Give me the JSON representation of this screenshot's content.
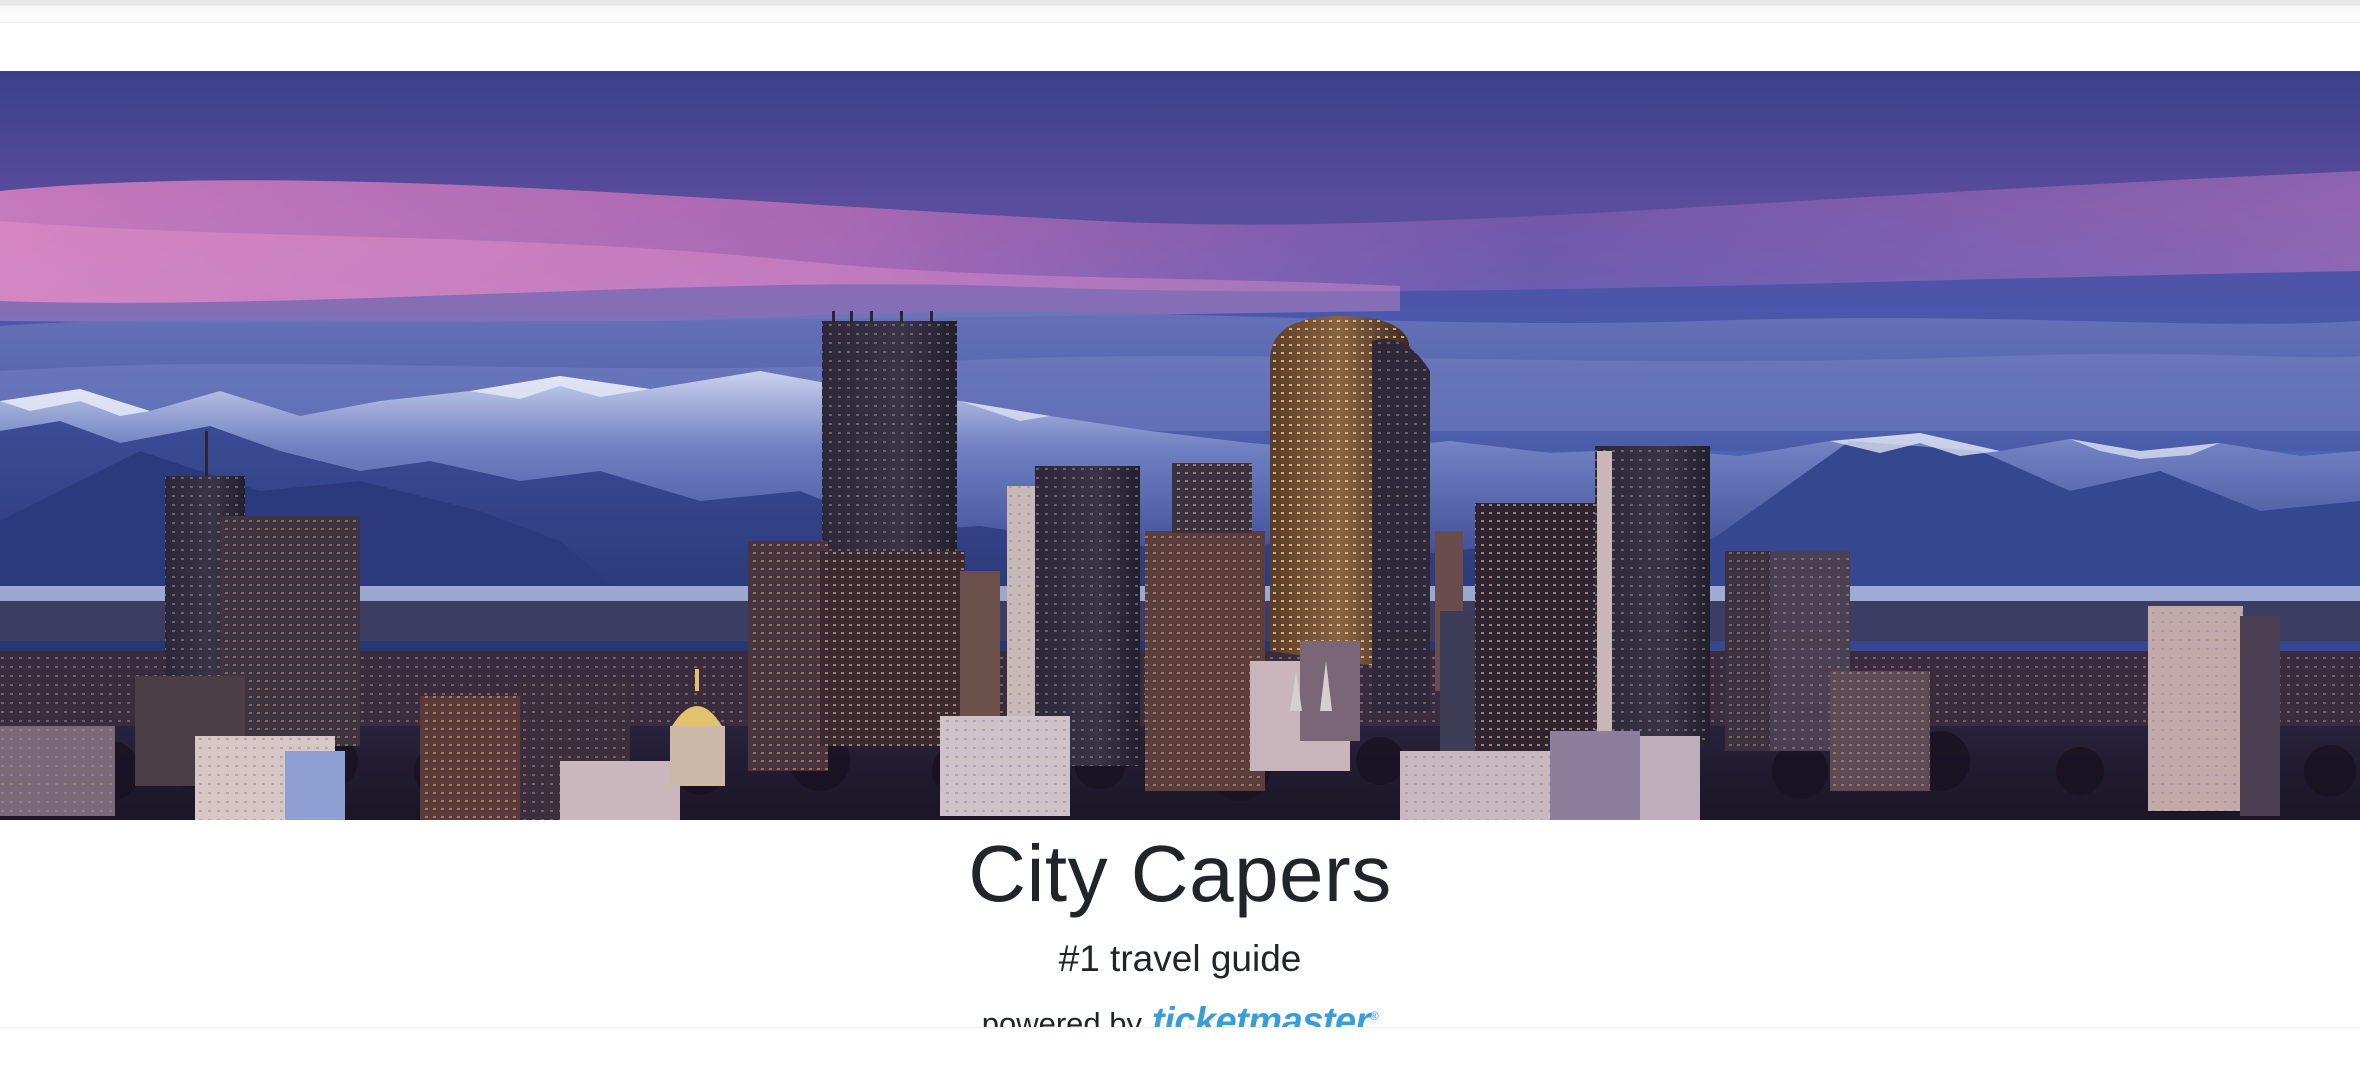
{
  "hero": {
    "alt": "City skyline at dusk with snow-capped mountains behind"
  },
  "brand": {
    "title": "City Capers",
    "tagline": "#1 travel guide",
    "powered_by": "powered by",
    "partner_logo_text": "ticketmaster",
    "partner_logo_mark": "®"
  },
  "colors": {
    "text": "#212529",
    "partner_brand": "#3a9ddb",
    "sky_top": "#3c4aa0",
    "sky_pink": "#e07ab8",
    "mountain": "#2d3f86"
  },
  "icons": {
    "partner_logo": "ticketmaster-logo"
  }
}
